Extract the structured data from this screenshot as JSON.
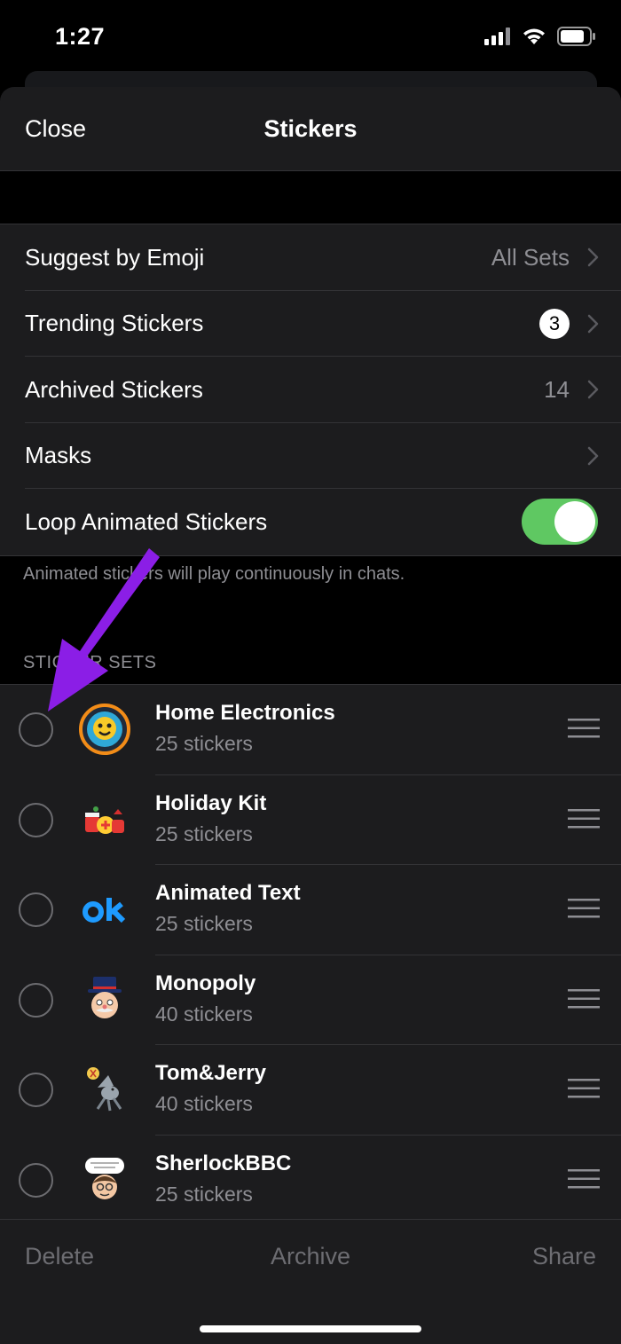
{
  "status_bar": {
    "time": "1:27"
  },
  "nav": {
    "close_label": "Close",
    "title": "Stickers"
  },
  "settings": {
    "suggest_label": "Suggest by Emoji",
    "suggest_value": "All Sets",
    "trending_label": "Trending Stickers",
    "trending_badge": "3",
    "archived_label": "Archived Stickers",
    "archived_value": "14",
    "masks_label": "Masks",
    "loop_label": "Loop Animated Stickers",
    "loop_on": true
  },
  "loop_footnote": "Animated stickers will play continuously in chats.",
  "sticker_sets_header": "STICKER SETS",
  "sticker_sets": [
    {
      "name": "Home Electronics",
      "count": "25 stickers"
    },
    {
      "name": "Holiday Kit",
      "count": "25 stickers"
    },
    {
      "name": "Animated Text",
      "count": "25 stickers"
    },
    {
      "name": "Monopoly",
      "count": "40 stickers"
    },
    {
      "name": "Tom&Jerry",
      "count": "40 stickers"
    },
    {
      "name": "SherlockBBC",
      "count": "25 stickers"
    }
  ],
  "toolbar": {
    "delete_label": "Delete",
    "archive_label": "Archive",
    "share_label": "Share"
  },
  "colors": {
    "accent_green": "#5fc862",
    "annotation_arrow": "#8b1ee6",
    "background": "#000000",
    "cell": "#1c1c1e"
  }
}
